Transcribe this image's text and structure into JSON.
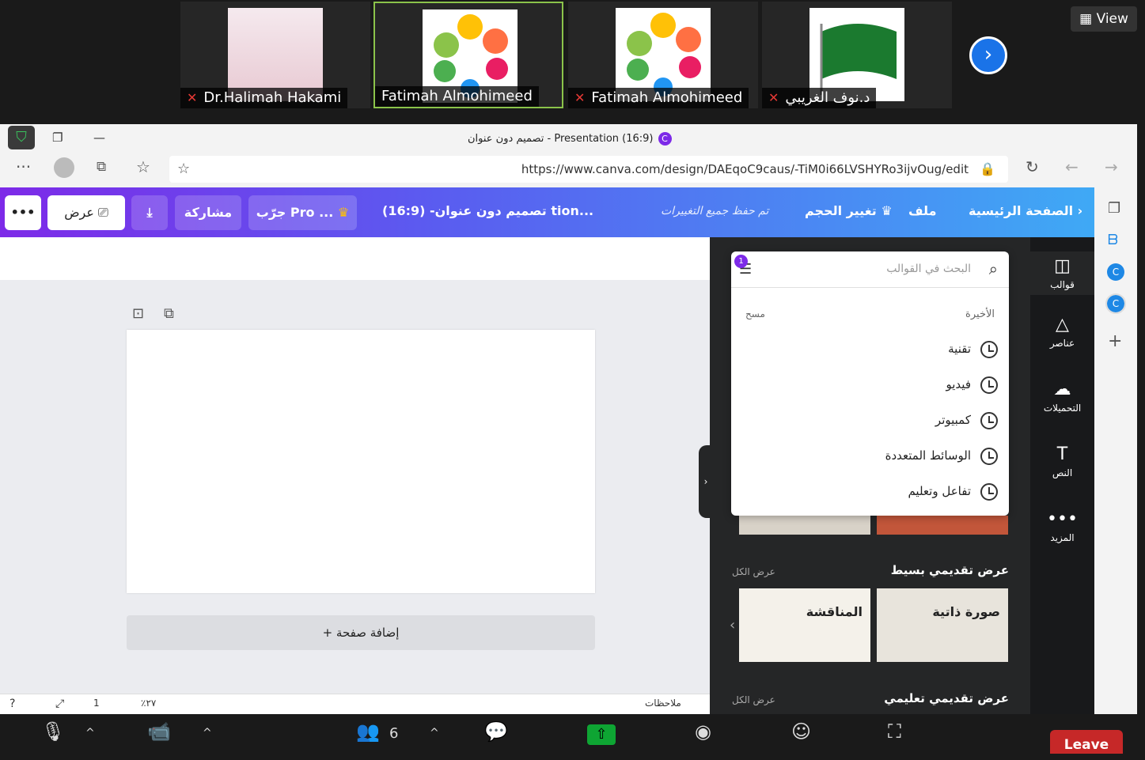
{
  "zoom": {
    "participants": [
      {
        "name": "Dr.Halimah Hakami",
        "muted": true
      },
      {
        "name": "Fatimah Almohimeed",
        "muted": false,
        "active": true
      },
      {
        "name": "Fatimah Almohimeed",
        "muted": true
      },
      {
        "name": "د.نوف الغريبي",
        "muted": true
      }
    ],
    "view_label": "View",
    "participant_count": "6",
    "leave_label": "Leave"
  },
  "browser": {
    "window_title": "تصميم دون عنوان - Presentation (16:9)",
    "url": "https://www.canva.com/design/DAEqoC9caus/-TiM0i66LVSHYRo3ijvOug/edit"
  },
  "canva": {
    "home": "الصفحة الرئيسية",
    "file": "ملف",
    "resize": "تغيير الحجم",
    "saved": "تم حفظ جميع التغييرات",
    "doc_title": "تصميم دون عنوان- (16:9) tion...",
    "try_pro": "جرّب Pro ...",
    "share": "مشاركة",
    "present": "عرض",
    "more": "•••",
    "add_page": "+ إضافة صفحة",
    "zoom_level": "٪٢٧",
    "notes": "ملاحظات",
    "page_num": "1"
  },
  "sidebar": [
    {
      "label": "قوالب",
      "icon": "templates-icon",
      "glyph": "◫"
    },
    {
      "label": "عناصر",
      "icon": "elements-icon",
      "glyph": "△"
    },
    {
      "label": "التحميلات",
      "icon": "upload-icon",
      "glyph": "☁"
    },
    {
      "label": "النص",
      "icon": "text-icon",
      "glyph": "T"
    },
    {
      "label": "المزيد",
      "icon": "more-icon",
      "glyph": "•••"
    }
  ],
  "search": {
    "placeholder": "البحث في القوالب",
    "filter_badge": "1",
    "recent_label": "الأخيرة",
    "clear_label": "مسح",
    "recent_items": [
      "تقنية",
      "فيديو",
      "كمبيوتر",
      "الوسائط المتعددة",
      "تفاعل وتعليم"
    ]
  },
  "sections": [
    {
      "title": "عرض تقديمي بسيط",
      "see_all": "عرض الكل",
      "cards": [
        "صورة ذاتية",
        "المناقشة"
      ]
    },
    {
      "title": "عرض تقديمي تعليمي",
      "see_all": "عرض الكل"
    }
  ],
  "colors": {
    "canva_purple": "#7d2ae8",
    "canva_blue": "#3fa9f5",
    "zoom_leave": "#c62828",
    "zoom_share": "#0ea533"
  }
}
